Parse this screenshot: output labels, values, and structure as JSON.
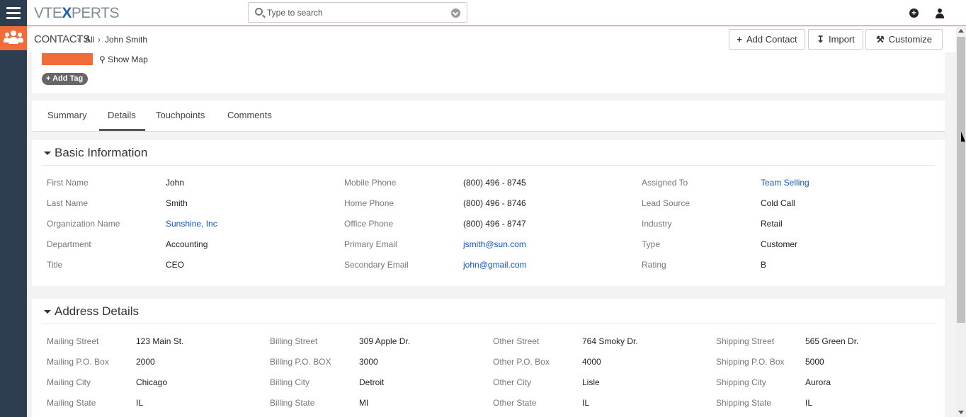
{
  "brand": {
    "logo_prefix": "VTE",
    "logo_x": "X",
    "logo_suffix": "PERTS",
    "accent": "#f26b38",
    "sidebar_color": "#2d3e50",
    "link_color": "#1155cc"
  },
  "search": {
    "placeholder": "Type to search"
  },
  "topbar_icons": [
    "plus-circle-icon",
    "user-icon"
  ],
  "breadcrumb": {
    "module": "CONTACTS",
    "list": "All",
    "record": "John Smith"
  },
  "header_buttons": {
    "add_contact": "Add Contact",
    "import": "Import",
    "customize": "Customize"
  },
  "record_header": {
    "show_map": "Show Map",
    "add_tag": "Add Tag"
  },
  "tabs": [
    {
      "label": "Summary"
    },
    {
      "label": "Details",
      "active": true
    },
    {
      "label": "Touchpoints"
    },
    {
      "label": "Comments"
    }
  ],
  "basic_info": {
    "title": "Basic Information",
    "col1": [
      {
        "label": "First Name",
        "value": "John"
      },
      {
        "label": "Last Name",
        "value": "Smith"
      },
      {
        "label": "Organization Name",
        "value": "Sunshine, Inc",
        "link": true
      },
      {
        "label": "Department",
        "value": "Accounting"
      },
      {
        "label": "Title",
        "value": "CEO"
      }
    ],
    "col2": [
      {
        "label": "Mobile Phone",
        "value": "(800) 496 - 8745"
      },
      {
        "label": "Home Phone",
        "value": "(800) 496 - 8746"
      },
      {
        "label": "Office Phone",
        "value": "(800) 496 - 8747"
      },
      {
        "label": "Primary Email",
        "value": "jsmith@sun.com",
        "link": true
      },
      {
        "label": "Secondary Email",
        "value": "john@gmail.com",
        "link": true
      }
    ],
    "col3": [
      {
        "label": "Assigned To",
        "value": "Team Selling",
        "link": true
      },
      {
        "label": "Lead Source",
        "value": "Cold Call"
      },
      {
        "label": "Industry",
        "value": "Retail"
      },
      {
        "label": "Type",
        "value": "Customer"
      },
      {
        "label": "Rating",
        "value": "B"
      }
    ]
  },
  "address": {
    "title": "Address Details",
    "col1": [
      {
        "label": "Mailing Street",
        "value": "123 Main St."
      },
      {
        "label": "Mailing P.O. Box",
        "value": "2000"
      },
      {
        "label": "Mailing City",
        "value": "Chicago"
      },
      {
        "label": "Mailing State",
        "value": "IL"
      }
    ],
    "col2": [
      {
        "label": "Billing Street",
        "value": "309 Apple Dr."
      },
      {
        "label": "Billing P.O. BOX",
        "value": "3000"
      },
      {
        "label": "Billing City",
        "value": "Detroit"
      },
      {
        "label": "Billing State",
        "value": "MI"
      }
    ],
    "col3": [
      {
        "label": "Other Street",
        "value": "764 Smoky Dr."
      },
      {
        "label": "Other P.O. Box",
        "value": "4000"
      },
      {
        "label": "Other City",
        "value": "Lisle"
      },
      {
        "label": "Other State",
        "value": "IL"
      }
    ],
    "col4": [
      {
        "label": "Shipping Street",
        "value": "565 Green Dr."
      },
      {
        "label": "Shipping P.O. Box",
        "value": "5000"
      },
      {
        "label": "Shipping City",
        "value": "Aurora"
      },
      {
        "label": "Shipping State",
        "value": "IL"
      }
    ]
  }
}
